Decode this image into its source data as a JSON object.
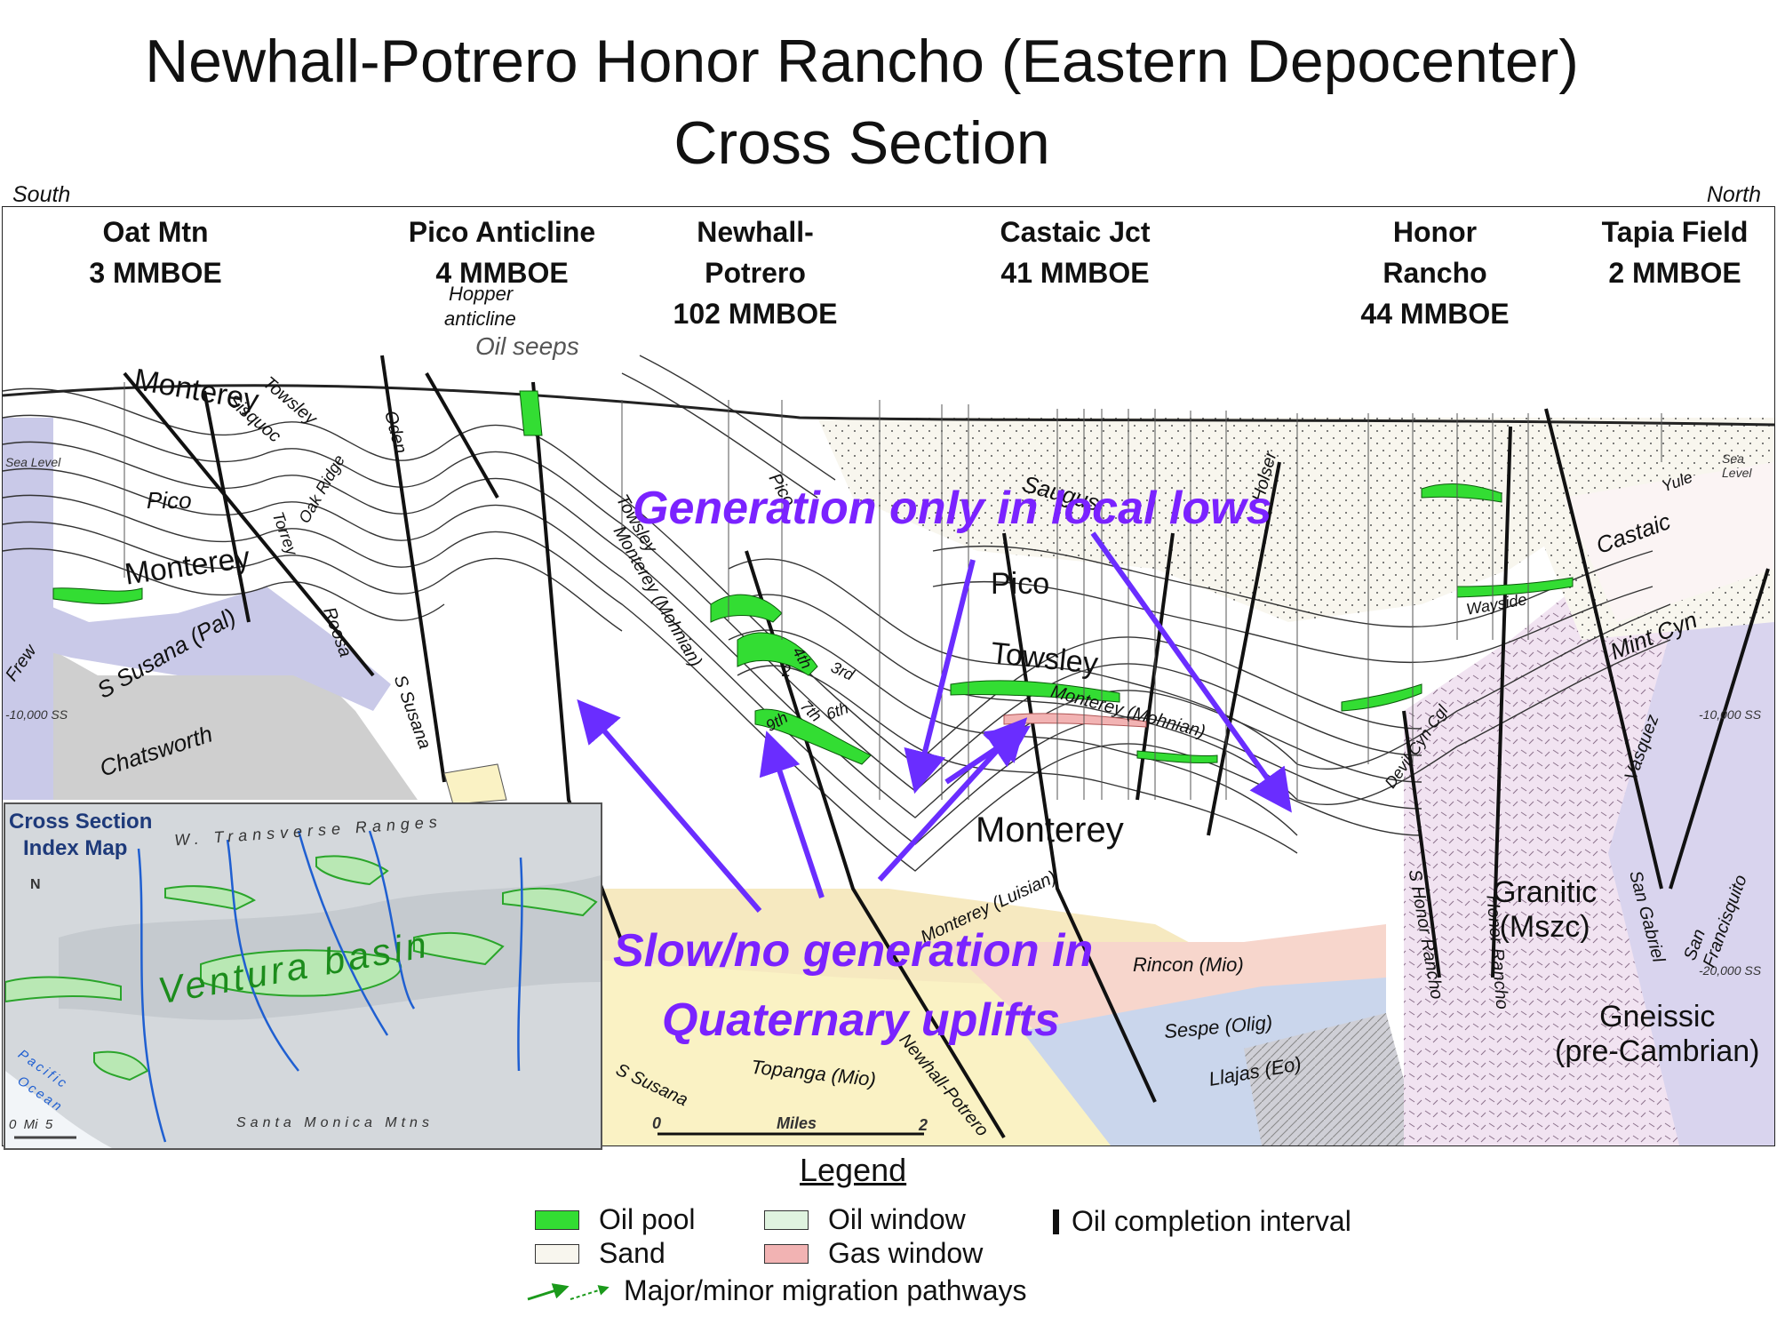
{
  "title": {
    "line1": "Newhall-Potrero Honor Rancho (Eastern Depocenter)",
    "line2": "Cross Section"
  },
  "compass": {
    "left": "South",
    "right": "North"
  },
  "fields": [
    {
      "name": "Oat Mtn",
      "reserves": "3 MMBOE"
    },
    {
      "name": "Pico Anticline",
      "reserves": "4 MMBOE"
    },
    {
      "name": "Newhall-",
      "name2": "Potrero",
      "reserves": "102 MMBOE"
    },
    {
      "name": "Castaic Jct",
      "reserves": "41 MMBOE"
    },
    {
      "name": "Honor",
      "name2": "Rancho",
      "reserves": "44 MMBOE"
    },
    {
      "name": "Tapia Field",
      "reserves": "2 MMBOE"
    }
  ],
  "annotations": {
    "hopper": "Hopper",
    "anticline": "anticline",
    "oil_seeps": "Oil seeps",
    "callout_top": "Generation only in local lows",
    "callout_bottom_1": "Slow/no generation in",
    "callout_bottom_2": "Quaternary uplifts",
    "sea_level_left": "Sea Level",
    "sea_level_right": "Sea Level",
    "depth_10k_left": "-10,000 SS",
    "depth_10k_right": "-10,000 SS",
    "depth_20k_right": "-20,000 SS",
    "scale_0": "0",
    "scale_miles": "Miles",
    "scale_2": "2"
  },
  "units": {
    "monterey_1": "Monterey",
    "monterey_2": "Monterey",
    "monterey_3": "Monterey",
    "pico_1": "Pico",
    "pico_2": "Pico",
    "towsley": "Towsley",
    "saugus": "Saugus",
    "chatsworth": "Chatsworth",
    "s_susana_pal": "S Susana (Pal)",
    "granitic": "Granitic",
    "granitic_code": "(Mszc)",
    "gneissic": "Gneissic",
    "gneissic_age": "(pre-Cambrian)",
    "castaic": "Castaic",
    "mint_cyn": "Mint Cyn",
    "yule": "Yule",
    "rincon": "Rincon (Mio)",
    "sespe": "Sespe (Olig)",
    "llajas": "Llajas (Eo)",
    "topanga": "Topanga (Mio)",
    "monterey_luisian": "Monterey (Luisian)",
    "monterey_mohnian": "Monterey (Mohnian)",
    "towsley_small": "Towsley",
    "monterey_mohnian_2": "Monterey (Mohnian)",
    "frew": "Frew",
    "roosa": "Roosa",
    "s_susana_fault": "S Susana",
    "s_susana_fault_2": "S Susana",
    "oden": "Oden",
    "holser": "Holser",
    "newhall_potrero_fault": "Newhall-Potrero",
    "s_honor_rancho": "S Honor Rancho",
    "honor_rancho_fault": "Honor Rancho",
    "san_gabriel": "San Gabriel",
    "san_francisquito": "San Francisquito",
    "vasquez": "Vasquez",
    "devil_cyn": "Devil Cyn Cgl",
    "wayside": "Wayside",
    "sisquoc": "Sisquoc",
    "towsley_left": "Towsley",
    "oak_ridge": "Oak Ridge",
    "torrey": "Torrey",
    "pico_fault": "Pico",
    "zone_2": "2",
    "zone_3rd": "3rd",
    "zone_4th": "4th",
    "zone_6th": "6th",
    "zone_7th": "7th",
    "zone_9th": "9th"
  },
  "map": {
    "title_1": "Cross Section",
    "title_2": "Index Map",
    "ranges": "W. Transverse Ranges",
    "basin": "Ventura basin",
    "ocean_1": "Pacific",
    "ocean_2": "Ocean",
    "mountains": "Santa Monica Mtns",
    "north": "N",
    "scale": "0  Mi  5"
  },
  "legend": {
    "title": "Legend",
    "oil_pool": "Oil pool",
    "sand": "Sand",
    "oil_window": "Oil window",
    "gas_window": "Gas window",
    "completion": "Oil completion interval",
    "migration": "Major/minor migration pathways"
  },
  "colors": {
    "oil_pool": "#33dd33",
    "oil_window": "#dff3df",
    "gas_window": "#f2b3b3",
    "callout": "#7a22ff",
    "arrow": "#6a2dff",
    "granitic": "#f1e3f1",
    "gneissic": "#d9d4ee",
    "chatsworth": "#cfcfcf",
    "sespe": "#f7d6cc",
    "llajas": "#cad6ec",
    "topanga": "#faf2c4",
    "rincon": "#f6e9c0",
    "s_susana": "#c9c9e8",
    "saugus": "#f5f1e3"
  }
}
